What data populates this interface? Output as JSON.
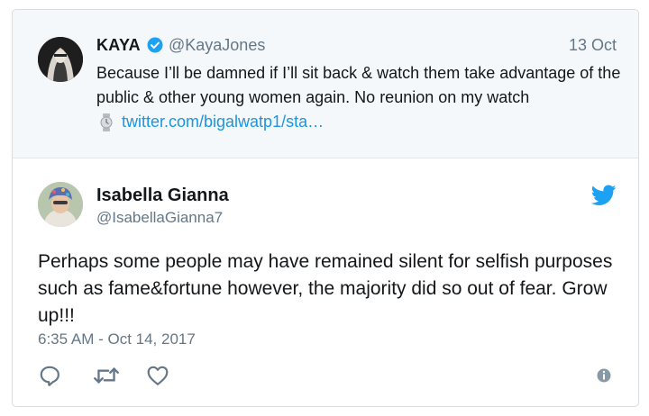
{
  "quoted_tweet": {
    "name": "KAYA",
    "handle": "@KayaJones",
    "date": "13 Oct",
    "text": "Because I’ll be damned if I’ll sit back & watch them take advantage of the public & other young women again. No reunion on my watch",
    "link": "twitter.com/bigalwatp1/sta…"
  },
  "tweet": {
    "name": "Isabella Gianna",
    "handle": "@IsabellaGianna7",
    "text": "Perhaps some people may have remained silent for selfish purposes such as fame&fortune however, the majority did so out of fear. Grow up!!!",
    "timestamp": "6:35 AM - Oct 14, 2017"
  },
  "icons": {
    "verified": "verified-badge-icon",
    "bird": "twitter-bird-icon",
    "reply": "reply-icon",
    "retweet": "retweet-icon",
    "like": "heart-icon",
    "info": "info-icon",
    "link": "watch-emoji-icon"
  },
  "colors": {
    "accent": "#1da1f2",
    "link": "#1b95e0",
    "secondary_text": "#657786",
    "primary_text": "#14171a",
    "quoted_bg": "#f5f8fa"
  }
}
